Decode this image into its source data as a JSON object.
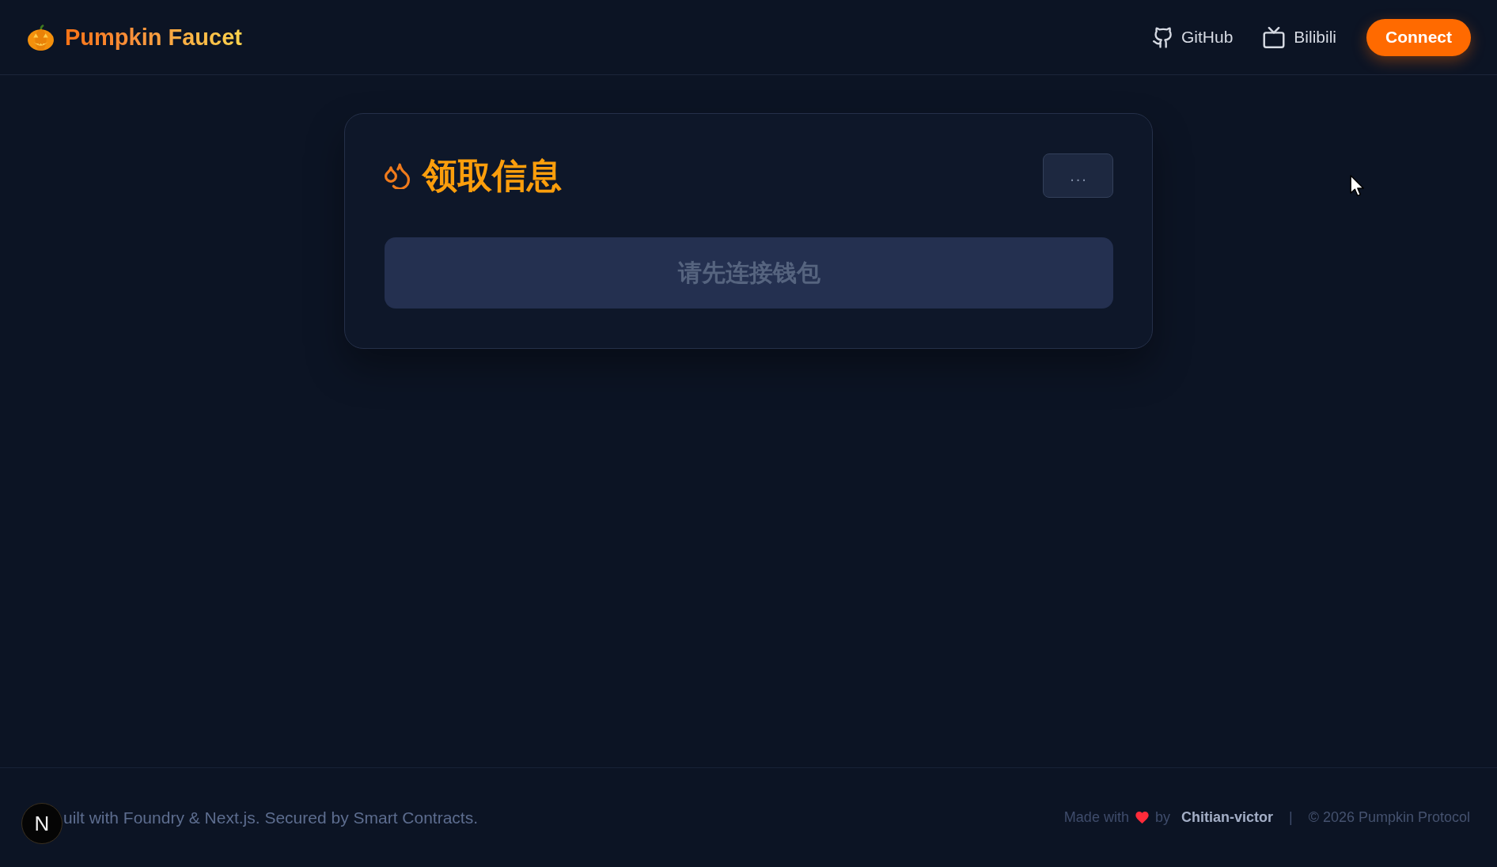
{
  "header": {
    "logo_text": "Pumpkin Faucet",
    "links": [
      {
        "label": "GitHub",
        "kind": "github"
      },
      {
        "label": "Bilibili",
        "kind": "tv"
      }
    ],
    "connect_button": "Connect"
  },
  "card": {
    "title": "领取信息",
    "menu_button": "...",
    "action_button": {
      "label": "请先连接钱包",
      "disabled": true
    }
  },
  "footer": {
    "left_text": "uilt with Foundry & Next.js. Secured by Smart Contracts.",
    "made_with": "Made with",
    "by": "by",
    "author": "Chitian-victor",
    "separator": "|",
    "copyright": "© 2026 Pumpkin Protocol"
  },
  "dev_badge": {
    "label": "N"
  }
}
